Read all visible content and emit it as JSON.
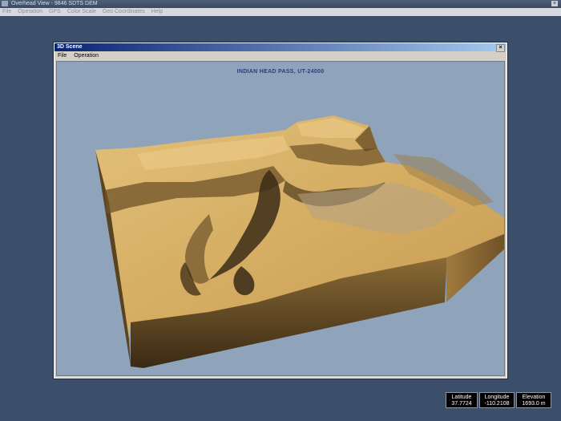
{
  "main_window": {
    "title": "Overhead View - 9846 SDTS DEM",
    "close_glyph": "×",
    "menu": [
      "File",
      "Operation",
      "GPS",
      "Color Scale",
      "Geo Coordinates",
      "Help"
    ]
  },
  "scene_window": {
    "title": "3D Scene",
    "close_glyph": "×",
    "menu": [
      "File",
      "Operation"
    ],
    "heading": "INDIAN HEAD PASS, UT-24000",
    "background_color": "#8fa4bb",
    "terrain_color": "#d9b46a"
  },
  "readouts": [
    {
      "label": "Latitude",
      "value": "37.7724"
    },
    {
      "label": "Longitude",
      "value": "-110.2108"
    },
    {
      "label": "Elevation",
      "value": "1693.0 m"
    }
  ]
}
